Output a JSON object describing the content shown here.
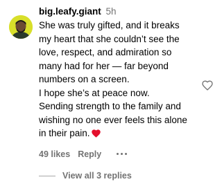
{
  "comment": {
    "username": "big.leafy.giant",
    "timestamp": "5h",
    "lines": [
      "She was truly gifted, and it breaks",
      "my heart that she couldn’t see the",
      "love, respect, and admiration so",
      "many had for her — far beyond",
      "numbers on a screen.",
      "I hope she’s at peace now.",
      "Sending strength to the family and",
      "wishing no one ever feels this alone",
      "in their pain."
    ],
    "likes": "49 likes",
    "reply_label": "Reply",
    "view_replies_label": "View all 3 replies"
  },
  "icons": {
    "avatar": "avatar-image",
    "heart_emoji": "red-heart-emoji",
    "more": "more-options-icon",
    "like": "heart-outline-icon"
  },
  "colors": {
    "secondary_text": "#737373",
    "heart_red": "#e3102c",
    "avatar_bg": "#d8df2a"
  }
}
